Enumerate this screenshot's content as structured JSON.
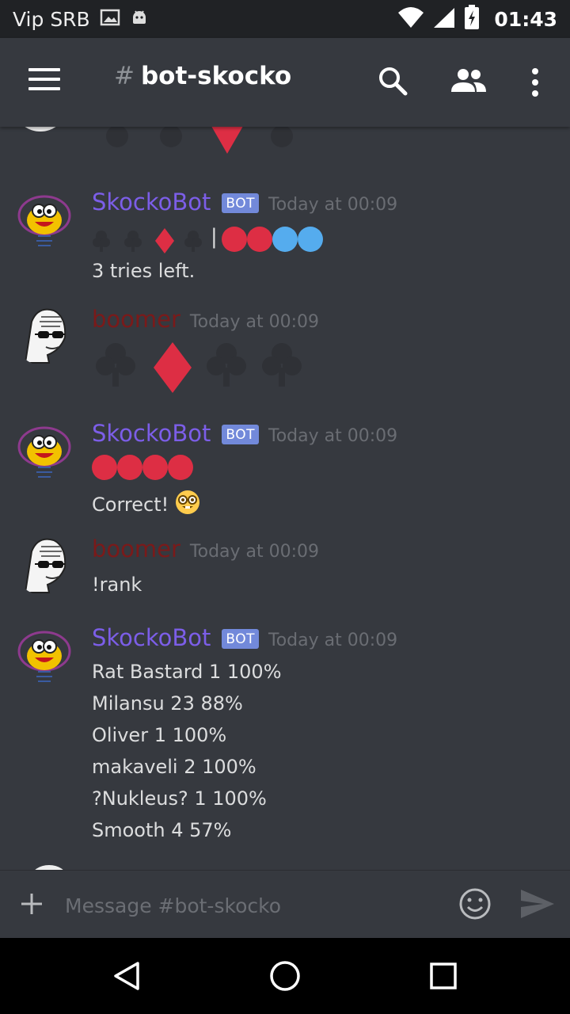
{
  "status_bar": {
    "carrier": "Vip SRB",
    "time": "01:43",
    "icons": [
      "image-icon",
      "android-icon",
      "wifi-icon",
      "signal-icon",
      "battery-charging-icon"
    ]
  },
  "app_bar": {
    "hash": "#",
    "channel_name": "bot-skocko",
    "icons": [
      "menu-icon",
      "search-icon",
      "members-icon",
      "more-vert-icon"
    ]
  },
  "messages": [
    {
      "author": "SkockoBot",
      "badge": "BOT",
      "timestamp": "Today at 00:09",
      "guess_symbols": [
        "club",
        "club",
        "diamond",
        "club"
      ],
      "separator": "|",
      "result_circles": [
        "red",
        "red",
        "blue",
        "blue"
      ],
      "text": "3 tries left."
    },
    {
      "author": "boomer",
      "timestamp": "Today at 00:09",
      "guess_symbols": [
        "club",
        "diamond",
        "club",
        "club"
      ]
    },
    {
      "author": "SkockoBot",
      "badge": "BOT",
      "timestamp": "Today at 00:09",
      "result_circles": [
        "red",
        "red",
        "red",
        "red"
      ],
      "text": "Correct!",
      "emoji": "nerd-face-icon"
    },
    {
      "author": "boomer",
      "timestamp": "Today at 00:09",
      "text": "!rank"
    },
    {
      "author": "SkockoBot",
      "badge": "BOT",
      "timestamp": "Today at 00:09",
      "lines": [
        "Rat Bastard 1 100%",
        "Milansu 23 88%",
        "Oliver 1 100%",
        "makaveli 2 100%",
        "?Nukleus? 1 100%",
        "Smooth 4 57%"
      ]
    }
  ],
  "composer": {
    "placeholder": "Message #bot-skocko",
    "icons": [
      "add-icon",
      "emoji-icon",
      "send-icon"
    ]
  },
  "nav_bar": {
    "icons": [
      "back-icon",
      "home-icon",
      "recents-icon"
    ]
  },
  "colors": {
    "background": "#36393f",
    "bot_name": "#7c5ee8",
    "boomer_name": "#7a1a1a",
    "bot_badge": "#7289da",
    "red_circle": "#dd2e44",
    "blue_circle": "#55acee",
    "diamond": "#dd2e44",
    "club": "#2f3136"
  }
}
